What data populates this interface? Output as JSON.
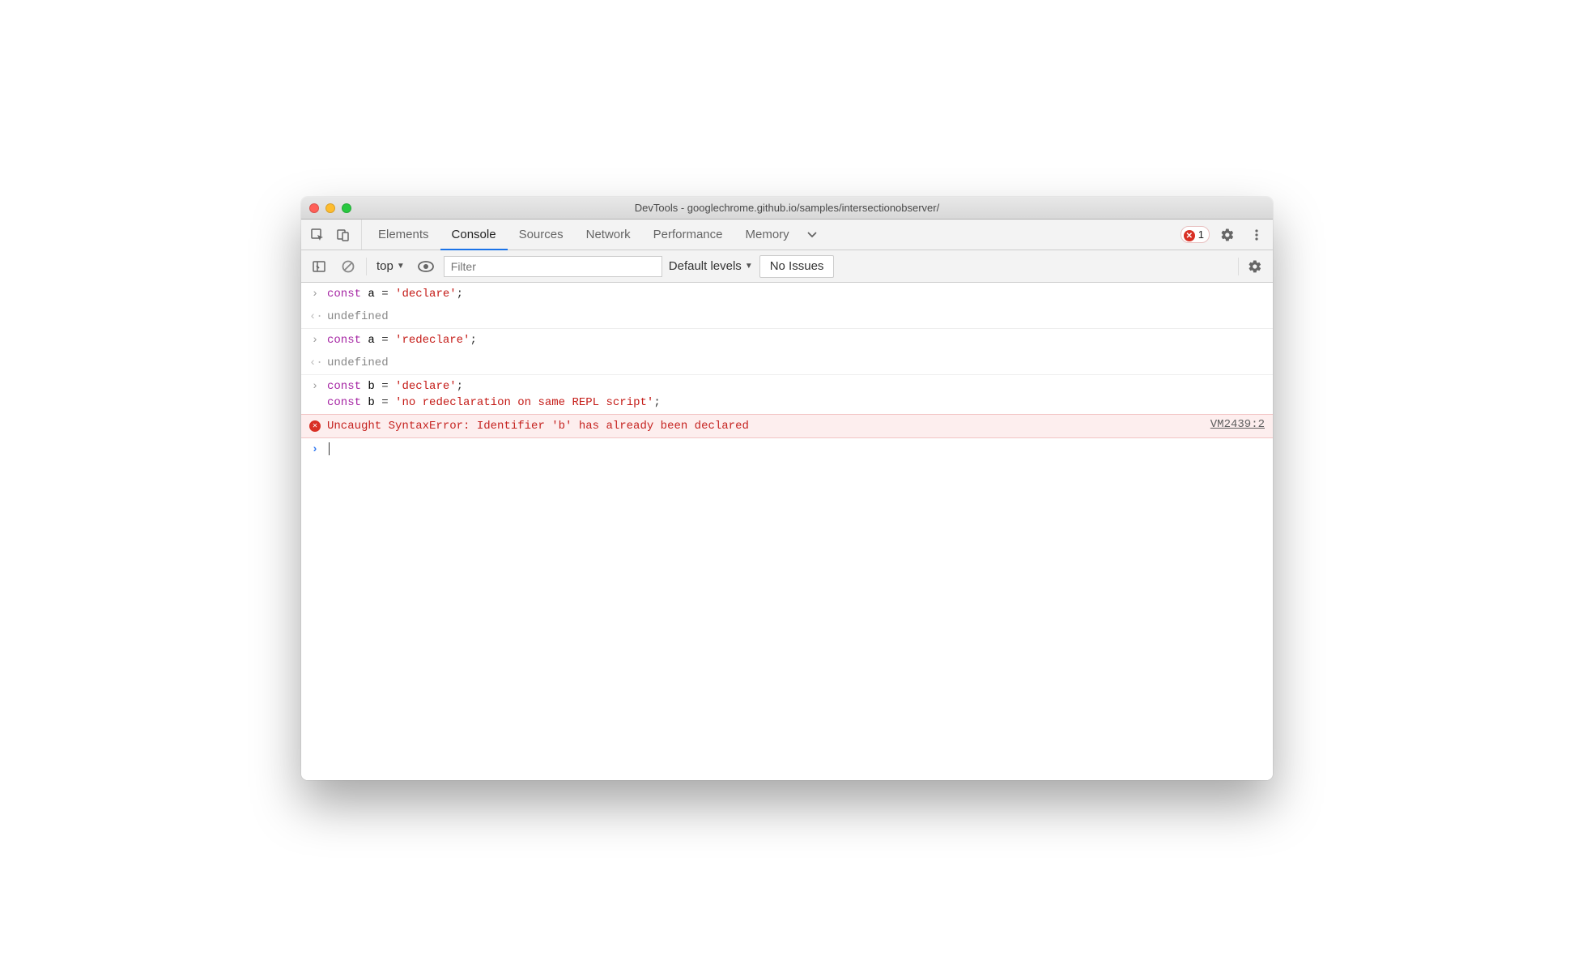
{
  "window_title": "DevTools - googlechrome.github.io/samples/intersectionobserver/",
  "tabs": [
    "Elements",
    "Console",
    "Sources",
    "Network",
    "Performance",
    "Memory"
  ],
  "active_tab": "Console",
  "error_count": "1",
  "toolbar": {
    "context": "top",
    "filter_placeholder": "Filter",
    "levels_label": "Default levels",
    "issues_label": "No Issues"
  },
  "console": {
    "rows": [
      {
        "type": "input",
        "tokens": [
          {
            "t": "kw",
            "v": "const"
          },
          {
            "t": "txt",
            "v": " a "
          },
          {
            "t": "op",
            "v": "="
          },
          {
            "t": "txt",
            "v": " "
          },
          {
            "t": "str",
            "v": "'declare'"
          },
          {
            "t": "op",
            "v": ";"
          }
        ]
      },
      {
        "type": "output",
        "text": "undefined"
      },
      {
        "type": "input",
        "tokens": [
          {
            "t": "kw",
            "v": "const"
          },
          {
            "t": "txt",
            "v": " a "
          },
          {
            "t": "op",
            "v": "="
          },
          {
            "t": "txt",
            "v": " "
          },
          {
            "t": "str",
            "v": "'redeclare'"
          },
          {
            "t": "op",
            "v": ";"
          }
        ]
      },
      {
        "type": "output",
        "text": "undefined"
      },
      {
        "type": "input-multi",
        "lines": [
          [
            {
              "t": "kw",
              "v": "const"
            },
            {
              "t": "txt",
              "v": " b "
            },
            {
              "t": "op",
              "v": "="
            },
            {
              "t": "txt",
              "v": " "
            },
            {
              "t": "str",
              "v": "'declare'"
            },
            {
              "t": "op",
              "v": ";"
            }
          ],
          [
            {
              "t": "kw",
              "v": "const"
            },
            {
              "t": "txt",
              "v": " b "
            },
            {
              "t": "op",
              "v": "="
            },
            {
              "t": "txt",
              "v": " "
            },
            {
              "t": "str",
              "v": "'no redeclaration on same REPL script'"
            },
            {
              "t": "op",
              "v": ";"
            }
          ]
        ]
      },
      {
        "type": "error",
        "text": "Uncaught SyntaxError: Identifier 'b' has already been declared",
        "source": "VM2439:2"
      }
    ]
  }
}
